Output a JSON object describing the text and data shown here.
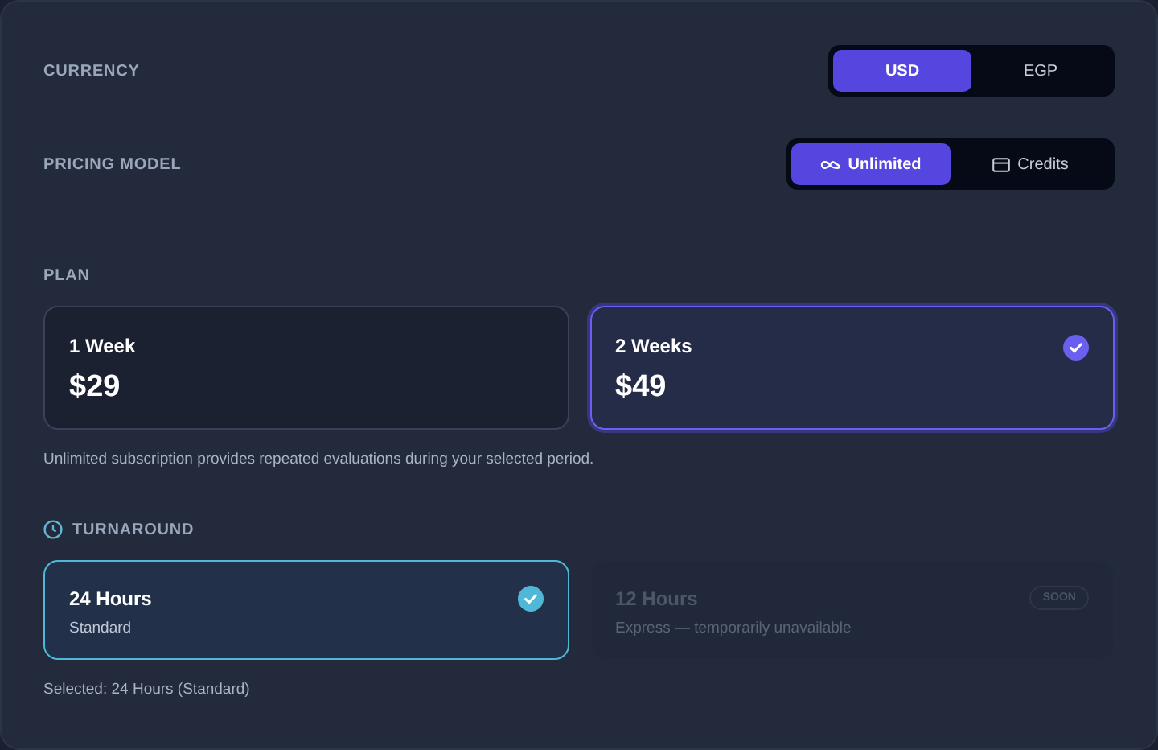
{
  "currency": {
    "label": "CURRENCY",
    "options": [
      {
        "label": "USD",
        "selected": true
      },
      {
        "label": "EGP",
        "selected": false
      }
    ]
  },
  "pricing_model": {
    "label": "PRICING MODEL",
    "options": [
      {
        "label": "Unlimited",
        "kind": "infinity",
        "selected": true
      },
      {
        "label": "Credits",
        "kind": "card",
        "selected": false
      }
    ]
  },
  "plan": {
    "label": "PLAN",
    "options": [
      {
        "name": "1 Week",
        "price": "$29",
        "selected": false
      },
      {
        "name": "2 Weeks",
        "price": "$49",
        "selected": true
      }
    ],
    "note": "Unlimited subscription provides repeated evaluations during your selected period."
  },
  "turnaround": {
    "label": "TURNAROUND",
    "options": [
      {
        "name": "24 Hours",
        "description": "Standard",
        "selected": true,
        "disabled": false
      },
      {
        "name": "12 Hours",
        "description": "Express — temporarily unavailable",
        "selected": false,
        "disabled": true,
        "badge": "SOON"
      }
    ],
    "summary": "Selected: 24 Hours (Standard)"
  }
}
